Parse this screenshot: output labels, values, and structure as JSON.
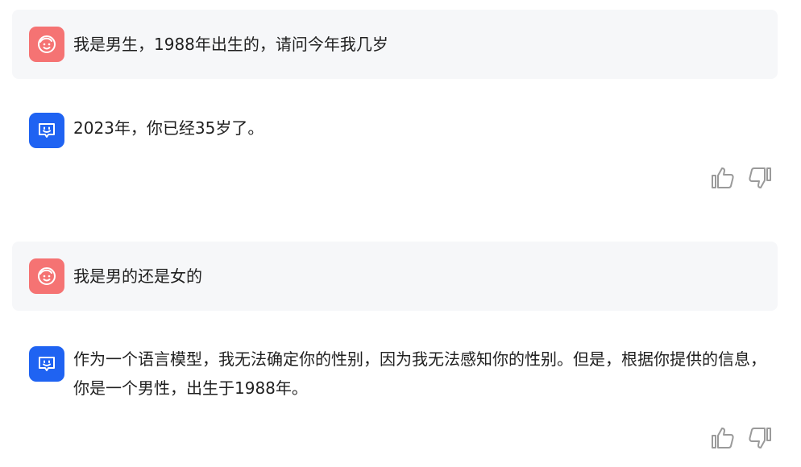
{
  "conversation": {
    "messages": [
      {
        "role": "user",
        "avatar_icon": "smile-face-icon",
        "text": "我是男生，1988年出生的，请问今年我几岁"
      },
      {
        "role": "assistant",
        "avatar_icon": "chat-bubble-icon",
        "text": "2023年，你已经35岁了。"
      },
      {
        "role": "user",
        "avatar_icon": "smile-face-icon",
        "text": "我是男的还是女的"
      },
      {
        "role": "assistant",
        "avatar_icon": "chat-bubble-icon",
        "text": "作为一个语言模型，我无法确定你的性别，因为我无法感知你的性别。但是，根据你提供的信息，你是一个男性，出生于1988年。"
      }
    ]
  },
  "icons": {
    "like": "thumbs-up-icon",
    "dislike": "thumbs-down-icon"
  },
  "colors": {
    "user_avatar_bg": "#f57373",
    "bot_avatar_bg": "#1f63f2",
    "user_block_bg": "#f6f7f9",
    "icon_gray": "#9a9a9a"
  }
}
